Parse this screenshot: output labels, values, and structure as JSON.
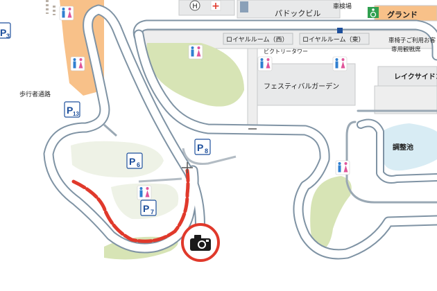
{
  "map": {
    "labels": {
      "paddock_building": "パドックビル",
      "inspection": "車検場",
      "grand": "グランド",
      "royal_west": "ロイヤルルーム（西）",
      "royal_east": "ロイヤルルーム（東）",
      "victory_tower": "ビクトリータワー",
      "festival_garden": "フェスティバルガーデン",
      "lakeside": "レイクサイドコ",
      "pond": "調整池",
      "walkway": "歩行者通路",
      "wheelchair_seat_1": "車椅子ご利用お客",
      "wheelchair_seat_2": "専用観戦席"
    },
    "parking": {
      "p3": "3",
      "p13": "13",
      "p6": "6",
      "p7": "7",
      "p8": "8"
    },
    "symbols": {
      "hospital": "H",
      "cross": "+",
      "parking_letter": "P"
    },
    "colors": {
      "track": "#7f93a4",
      "track_surface": "#ffffff",
      "grass": "#d7e4b5",
      "building": "#e8e9ea",
      "grandstand_orange": "#f8c189",
      "highlight_red": "#e0392b",
      "camera_ring": "#e0392b",
      "parking_blue": "#1d4f9c",
      "wheelchair_green": "#2f9f4f",
      "toilet_male": "#2f7fd0",
      "toilet_female": "#e0559a"
    },
    "icons": [
      "toilet-icon",
      "wheelchair-icon",
      "hospital-icon",
      "first-aid-icon",
      "camera-icon",
      "parking-icon"
    ]
  }
}
